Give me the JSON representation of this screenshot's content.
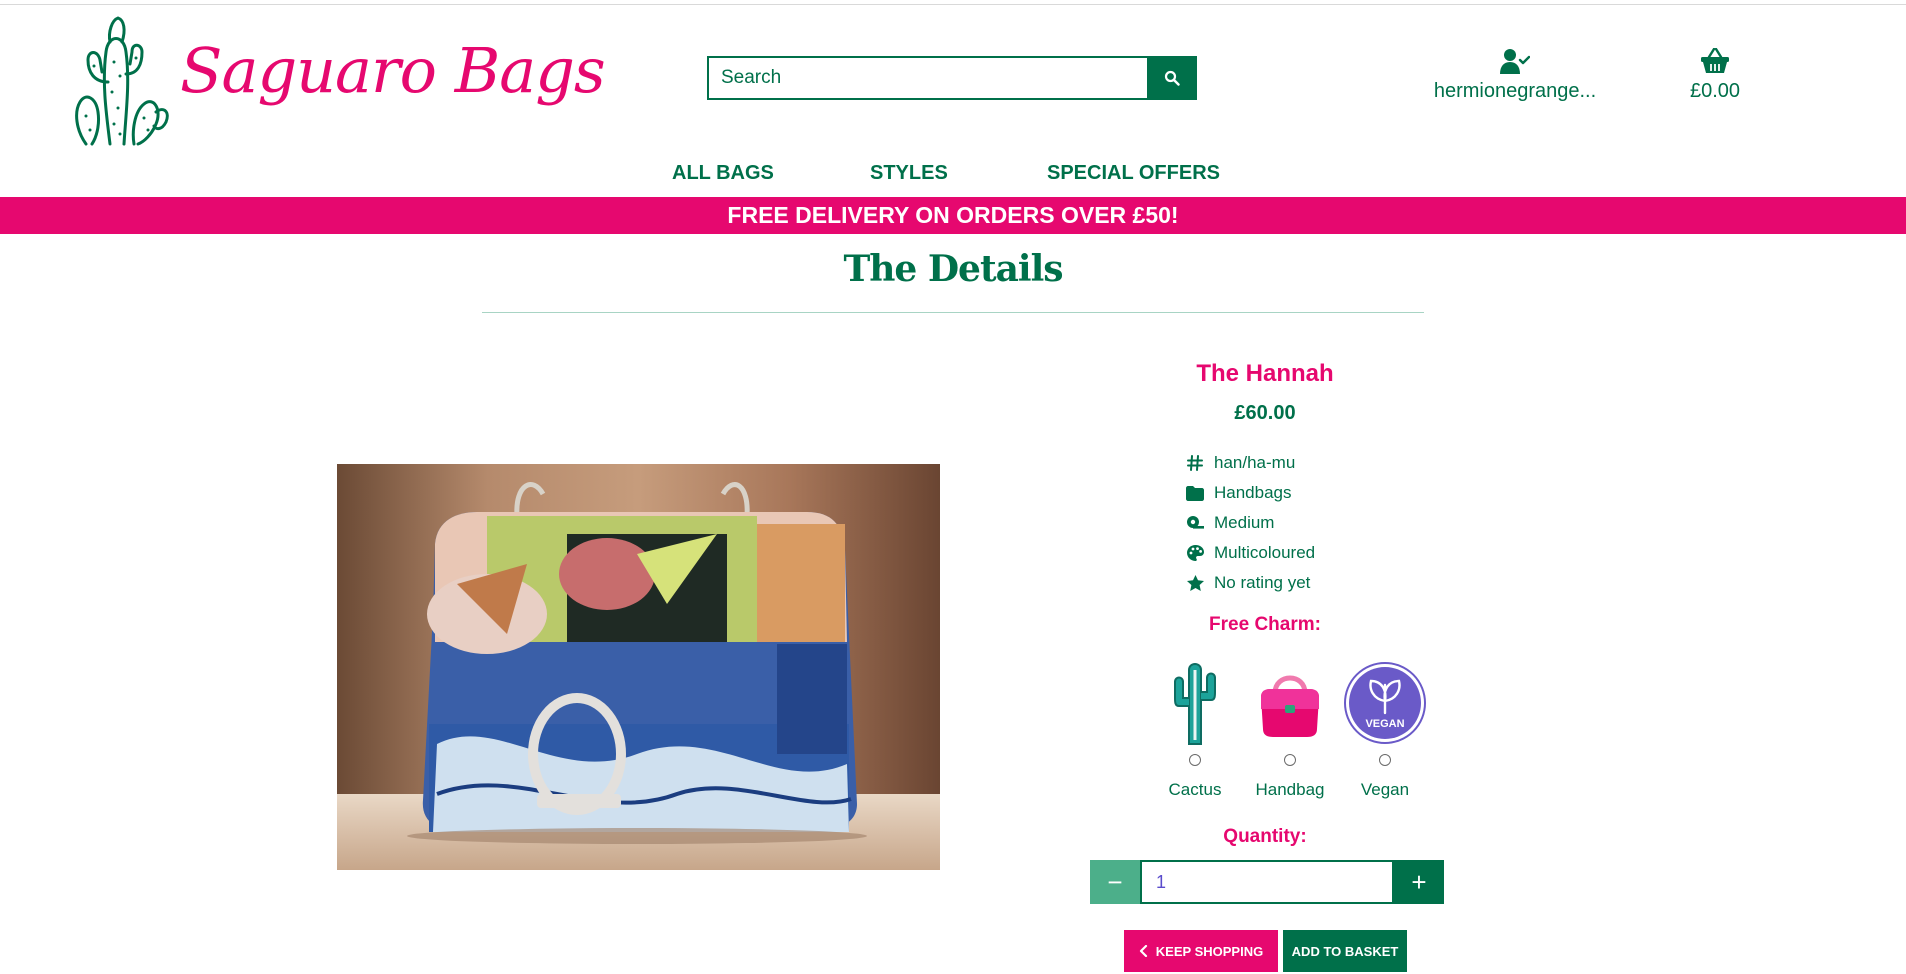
{
  "brand": {
    "name": "Saguaro Bags",
    "accent": "#e6086f",
    "primary": "#00704a"
  },
  "search": {
    "placeholder": "Search",
    "icon": "search-icon"
  },
  "account": {
    "username": "hermionegrange...",
    "icon": "user-check-icon"
  },
  "cart": {
    "total": "£0.00",
    "icon": "basket-icon"
  },
  "nav": {
    "items": [
      {
        "label": "ALL BAGS"
      },
      {
        "label": "STYLES"
      },
      {
        "label": "SPECIAL OFFERS"
      }
    ]
  },
  "banner": {
    "text": "FREE DELIVERY ON ORDERS OVER £50!"
  },
  "page": {
    "title": "The Details"
  },
  "product": {
    "name": "The Hannah",
    "price": "£60.00",
    "meta": [
      {
        "icon": "hashtag-icon",
        "text": "han/ha-mu"
      },
      {
        "icon": "folder-icon",
        "text": "Handbags"
      },
      {
        "icon": "tape-measure-icon",
        "text": "Medium"
      },
      {
        "icon": "palette-icon",
        "text": "Multicoloured"
      },
      {
        "icon": "star-icon",
        "text": "No rating yet"
      }
    ]
  },
  "charm": {
    "label": "Free Charm:",
    "options": [
      {
        "label": "Cactus"
      },
      {
        "label": "Handbag"
      },
      {
        "label": "Vegan",
        "badge_text": "VEGAN"
      }
    ]
  },
  "quantity": {
    "label": "Quantity:",
    "value": "1",
    "minus": "−",
    "plus": "+"
  },
  "buttons": {
    "keep_shopping": "KEEP SHOPPING",
    "add_to_basket": "ADD TO BASKET"
  }
}
